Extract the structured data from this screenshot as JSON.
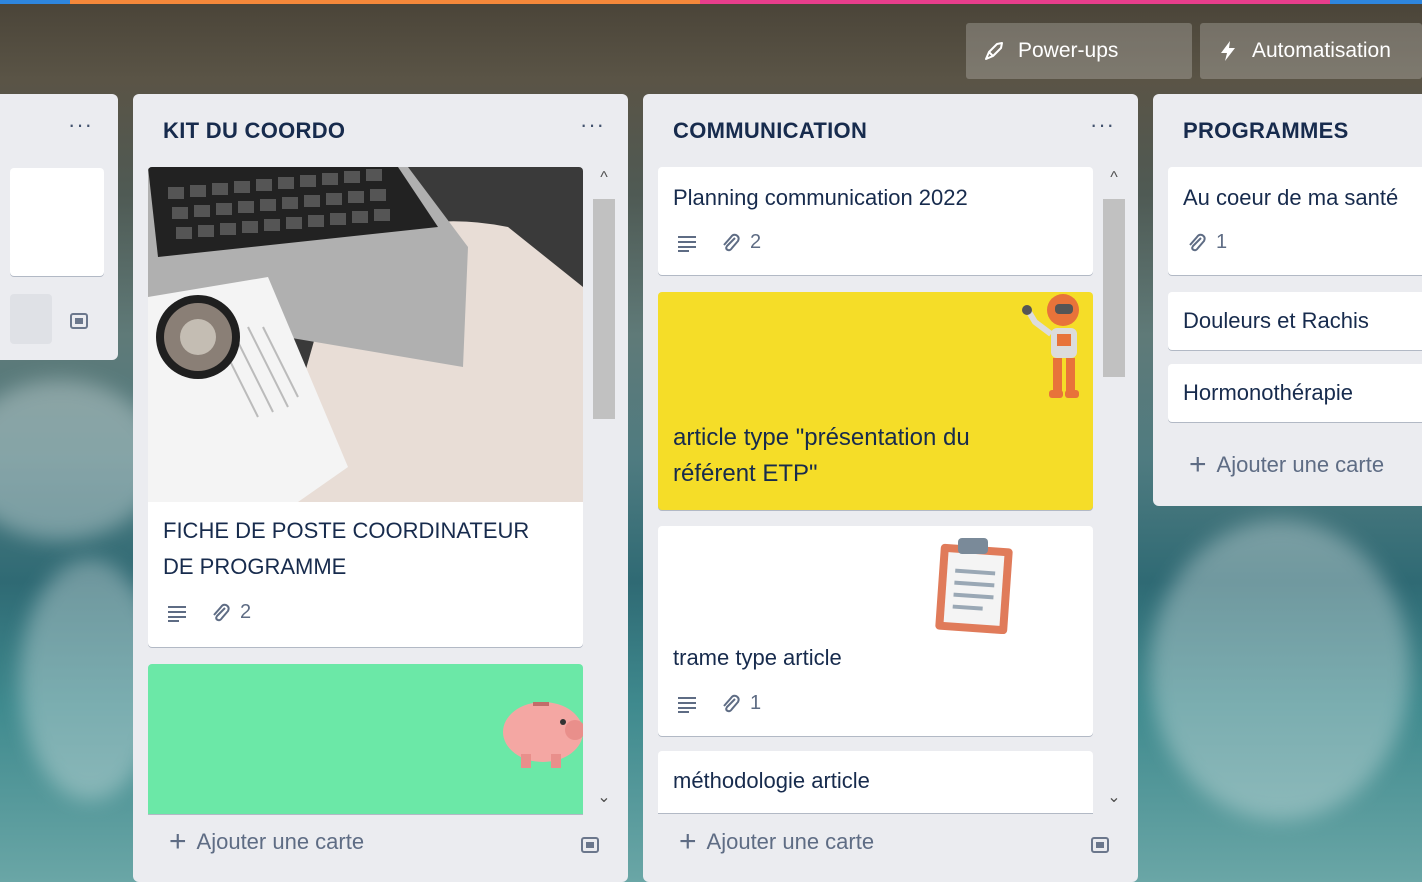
{
  "colors": {
    "list_bg": "#ebecf0",
    "yellow_cover": "#f5dd28",
    "green_cover": "#6be8a7",
    "topbar": [
      "#2e86de",
      "#f5883a",
      "#e83e8c",
      "#2e86de"
    ]
  },
  "header": {
    "powerups_label": "Power-ups",
    "powerups_icon": "rocket-icon",
    "automation_label": "Automatisation",
    "automation_icon": "lightning-icon"
  },
  "lists": {
    "left_partial": {
      "menu": "···"
    },
    "kit": {
      "title": "KIT DU COORDO",
      "menu": "···",
      "cards": [
        {
          "title_line1": "FICHE DE POSTE COORDINATEUR",
          "title_line2": "DE PROGRAMME",
          "attachments": "2",
          "cover": "laptop-photo"
        },
        {
          "cover": "green",
          "sticker": "piggy-bank"
        }
      ],
      "add_label": "Ajouter une carte"
    },
    "communication": {
      "title": "COMMUNICATION",
      "menu": "···",
      "cards": [
        {
          "title": "Planning communication 2022",
          "attachments": "2"
        },
        {
          "title_line1": "article type \"présentation du",
          "title_line2": "référent ETP\"",
          "cover": "yellow",
          "sticker": "robot"
        },
        {
          "title": "trame type article",
          "attachments": "1",
          "sticker": "clipboard"
        },
        {
          "title": "méthodologie article"
        }
      ],
      "add_label": "Ajouter une carte"
    },
    "programmes": {
      "title": "PROGRAMMES",
      "cards": [
        {
          "title": "Au coeur de ma santé",
          "attachments": "1"
        },
        {
          "title": "Douleurs et Rachis"
        },
        {
          "title": "Hormonothérapie"
        }
      ],
      "add_label": "Ajouter une carte"
    }
  }
}
